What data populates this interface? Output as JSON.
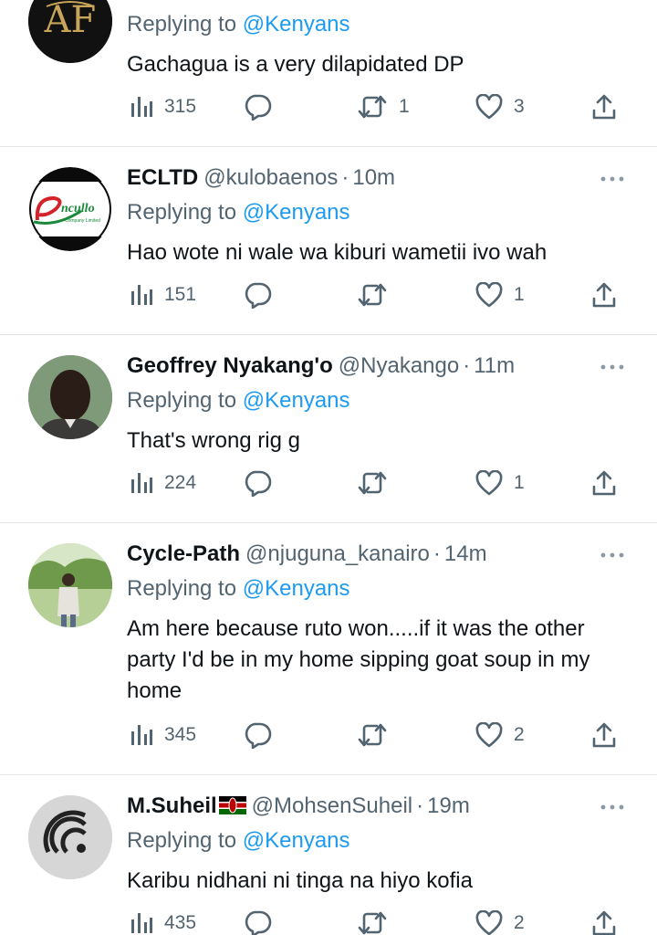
{
  "tweets": [
    {
      "username": "",
      "handle": "",
      "time": "",
      "reply_prefix": "Replying to",
      "reply_to": "@Kenyans",
      "text": "Gachagua is a very dilapidated DP",
      "views": "315",
      "replies": "",
      "retweets": "1",
      "likes": "3"
    },
    {
      "username": "ECLTD",
      "handle": "@kulobaenos",
      "time": "10m",
      "reply_prefix": "Replying to",
      "reply_to": "@Kenyans",
      "text": "Hao wote ni wale wa kiburi wametii ivo wah",
      "views": "151",
      "replies": "",
      "retweets": "",
      "likes": "1",
      "avatar_text": "ncullo",
      "avatar_subtext": "Company Limited"
    },
    {
      "username": "Geoffrey Nyakang'o",
      "handle": "@Nyakango",
      "time": "11m",
      "reply_prefix": "Replying to",
      "reply_to": "@Kenyans",
      "text": "That's wrong rig g",
      "views": "224",
      "replies": "",
      "retweets": "",
      "likes": "1"
    },
    {
      "username": "Cycle-Path",
      "handle": "@njuguna_kanairo",
      "time": "14m",
      "reply_prefix": "Replying to",
      "reply_to": "@Kenyans",
      "text": "Am here because ruto won.....if it was the other party I'd be in my home sipping goat soup in my home",
      "views": "345",
      "replies": "",
      "retweets": "",
      "likes": "2"
    },
    {
      "username": "M.Suheil",
      "handle": "@MohsenSuheil",
      "time": "19m",
      "reply_prefix": "Replying to",
      "reply_to": "@Kenyans",
      "text": "Karibu nidhani ni tinga na hiyo kofia",
      "views": "435",
      "replies": "",
      "retweets": "",
      "likes": "2",
      "flag": "kenya-flag-emoji"
    }
  ],
  "colors": {
    "text_primary": "#0f1419",
    "text_secondary": "#536471",
    "mention": "#1d9bf0",
    "divider": "#e3e6e8"
  },
  "icons": [
    "views-icon",
    "reply-icon",
    "retweet-icon",
    "like-icon",
    "share-icon",
    "more-icon"
  ]
}
